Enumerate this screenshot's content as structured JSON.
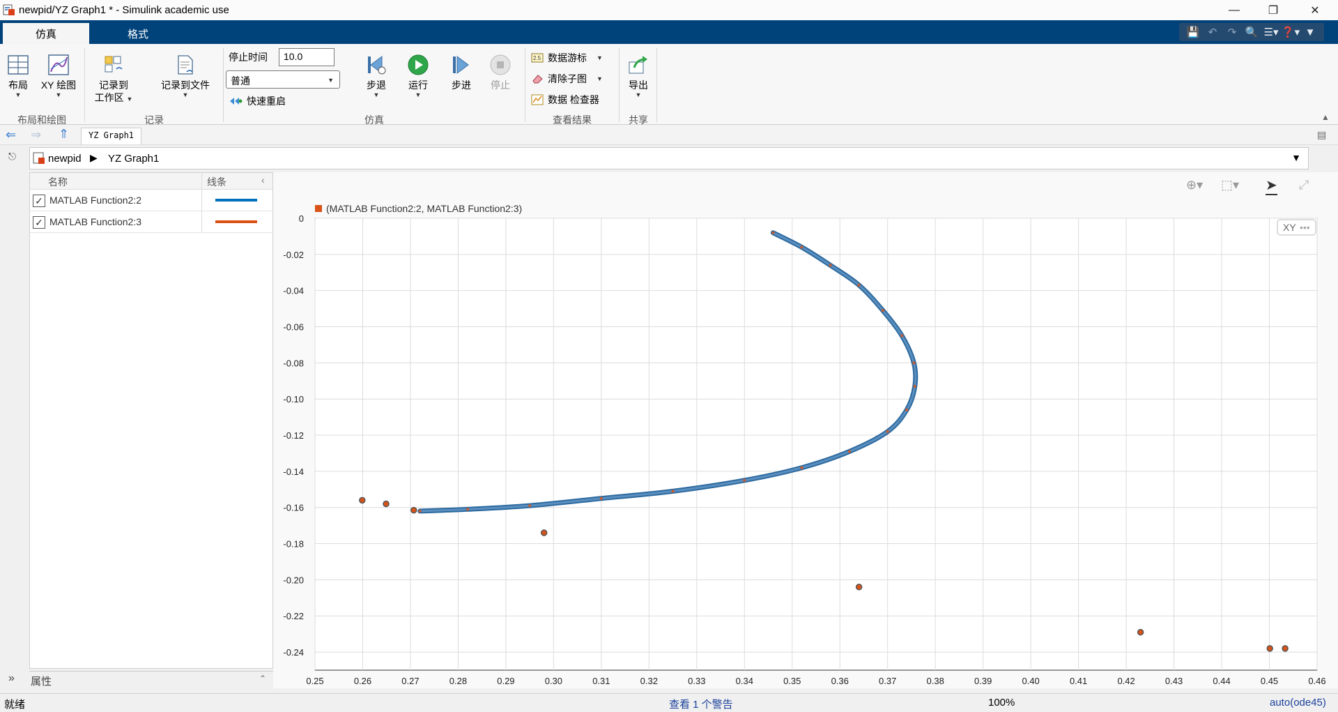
{
  "window": {
    "title": "newpid/YZ Graph1 * - Simulink academic use"
  },
  "ribbon_tabs": [
    "仿真",
    "格式"
  ],
  "ribbon": {
    "layout_label": "布局",
    "xy_plot_label": "XY 绘图",
    "section_layout": "布局和绘图",
    "log_to_workspace_line1": "记录到",
    "log_to_workspace_line2": "工作区",
    "log_to_file_label": "记录到文件",
    "section_record": "记录",
    "stop_time_label": "停止时间",
    "stop_time_value": "10.0",
    "sim_mode_value": "普通",
    "fast_restart_label": "快速重启",
    "step_back_label": "步退",
    "run_label": "运行",
    "step_forward_label": "步进",
    "stop_label": "停止",
    "section_simulate": "仿真",
    "data_cursor_label": "数据游标",
    "clear_subplot_label": "清除子图",
    "data_inspector_label": "数据 检查器",
    "section_review": "查看结果",
    "export_label": "导出",
    "section_share": "共享"
  },
  "nav": {
    "tab_label": "YZ Graph1"
  },
  "breadcrumb": {
    "root": "newpid",
    "current": "YZ Graph1"
  },
  "signal_panel": {
    "col_name": "名称",
    "col_line": "线条",
    "signals": [
      {
        "name": "MATLAB Function2:2",
        "color": "#0072bd",
        "checked": true
      },
      {
        "name": "MATLAB Function2:3",
        "color": "#d95319",
        "checked": true
      }
    ],
    "properties_label": "属性"
  },
  "plot": {
    "legend_text": "(MATLAB Function2:2, MATLAB Function2:3)",
    "badge": "XY"
  },
  "chart_data": {
    "type": "scatter",
    "legend": [
      "(MATLAB Function2:2, MATLAB Function2:3)"
    ],
    "xlim": [
      0.25,
      0.46
    ],
    "ylim": [
      -0.25,
      0
    ],
    "xticks": [
      "0.25",
      "0.26",
      "0.27",
      "0.28",
      "0.29",
      "0.30",
      "0.31",
      "0.32",
      "0.33",
      "0.34",
      "0.35",
      "0.36",
      "0.37",
      "0.38",
      "0.39",
      "0.40",
      "0.41",
      "0.42",
      "0.43",
      "0.44",
      "0.45",
      "0.46"
    ],
    "yticks": [
      "0",
      "-0.02",
      "-0.04",
      "-0.06",
      "-0.08",
      "-0.10",
      "-0.12",
      "-0.14",
      "-0.16",
      "-0.18",
      "-0.20",
      "-0.22",
      "-0.24"
    ],
    "grid": true,
    "curve": [
      {
        "x": 0.346,
        "y": -0.008
      },
      {
        "x": 0.352,
        "y": -0.016
      },
      {
        "x": 0.358,
        "y": -0.026
      },
      {
        "x": 0.364,
        "y": -0.037
      },
      {
        "x": 0.369,
        "y": -0.051
      },
      {
        "x": 0.373,
        "y": -0.065
      },
      {
        "x": 0.3755,
        "y": -0.08
      },
      {
        "x": 0.3757,
        "y": -0.093
      },
      {
        "x": 0.374,
        "y": -0.106
      },
      {
        "x": 0.37,
        "y": -0.118
      },
      {
        "x": 0.362,
        "y": -0.129
      },
      {
        "x": 0.352,
        "y": -0.138
      },
      {
        "x": 0.34,
        "y": -0.145
      },
      {
        "x": 0.325,
        "y": -0.151
      },
      {
        "x": 0.31,
        "y": -0.155
      },
      {
        "x": 0.295,
        "y": -0.159
      },
      {
        "x": 0.282,
        "y": -0.161
      },
      {
        "x": 0.272,
        "y": -0.162
      }
    ],
    "outliers": [
      {
        "x": 0.2599,
        "y": -0.156
      },
      {
        "x": 0.2649,
        "y": -0.158
      },
      {
        "x": 0.2707,
        "y": -0.1615
      },
      {
        "x": 0.298,
        "y": -0.174
      },
      {
        "x": 0.364,
        "y": -0.204
      },
      {
        "x": 0.423,
        "y": -0.229
      },
      {
        "x": 0.4501,
        "y": -0.238
      },
      {
        "x": 0.4533,
        "y": -0.238
      }
    ],
    "line_color": "#0072bd",
    "marker_color": "#d95319"
  },
  "status": {
    "ready": "就绪",
    "warning_link": "查看 1 个警告",
    "zoom": "100%",
    "solver": "auto(ode45)"
  }
}
